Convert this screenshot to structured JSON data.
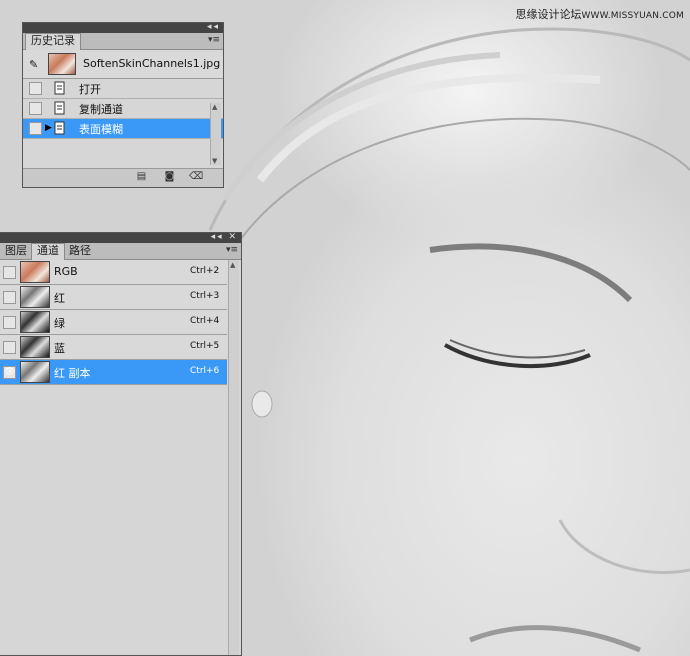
{
  "watermark": {
    "text": "思缘设计论坛",
    "site": "WWW.MISSYUAN.COM"
  },
  "history": {
    "tab": "历史记录",
    "snapshot": "SoftenSkinChannels1.jpg",
    "items": [
      {
        "label": "打开"
      },
      {
        "label": "复制通道"
      },
      {
        "label": "表面模糊"
      }
    ]
  },
  "channels": {
    "tabs": [
      "图层",
      "通道",
      "路径"
    ],
    "rows": [
      {
        "name": "RGB",
        "shortcut": "Ctrl+2"
      },
      {
        "name": "红",
        "shortcut": "Ctrl+3"
      },
      {
        "name": "绿",
        "shortcut": "Ctrl+4"
      },
      {
        "name": "蓝",
        "shortcut": "Ctrl+5"
      },
      {
        "name": "红 副本",
        "shortcut": "Ctrl+6"
      }
    ]
  },
  "icons": {
    "panel_collapse": "double-arrow-icon",
    "panel_close": "close-icon",
    "panel_menu": "panel-menu-icon",
    "history_brush": "history-brush-icon",
    "history_step": "history-state-icon",
    "visibility": "eye-icon",
    "new_document": "new-document-icon",
    "snapshot": "camera-icon",
    "delete": "trash-icon"
  },
  "colors": {
    "selection": "#3a99f7",
    "panel_bg": "#d6d6d6",
    "panel_bar": "#444444"
  }
}
